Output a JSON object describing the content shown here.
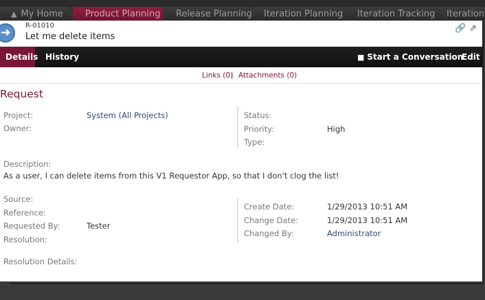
{
  "top_tabs": [
    {
      "label": "My Home"
    },
    {
      "label": "Product Planning"
    },
    {
      "label": "Release Planning"
    },
    {
      "label": "Iteration Planning"
    },
    {
      "label": "Iteration Tracking"
    },
    {
      "label": "Iteration"
    }
  ],
  "header": {
    "id": "R-01010",
    "title": "Let me delete items"
  },
  "toolbar": {
    "details": "Details",
    "history": "History",
    "conversation": "Start a Conversation",
    "edit": "Edit"
  },
  "links_bar": {
    "links": "Links (0)",
    "attachments": "Attachments (0)"
  },
  "section": {
    "title": "Request"
  },
  "fields": {
    "project_label": "Project:",
    "project_value": "System (All Projects)",
    "owner_label": "Owner:",
    "status_label": "Status:",
    "priority_label": "Priority:",
    "priority_value": "High",
    "type_label": "Type:",
    "description_label": "Description:",
    "description_value": "As a user, I can delete items from this V1 Requestor App, so that I don't clog the list!",
    "source_label": "Source:",
    "reference_label": "Reference:",
    "requested_by_label": "Requested By:",
    "requested_by_value": "Tester",
    "resolution_label": "Resolution:",
    "resolution_details_label": "Resolution Details:",
    "create_date_label": "Create Date:",
    "create_date_value": "1/29/2013 10:51 AM",
    "change_date_label": "Change Date:",
    "change_date_value": "1/29/2013 10:51 AM",
    "changed_by_label": "Changed By:",
    "changed_by_value": "Administrator"
  }
}
